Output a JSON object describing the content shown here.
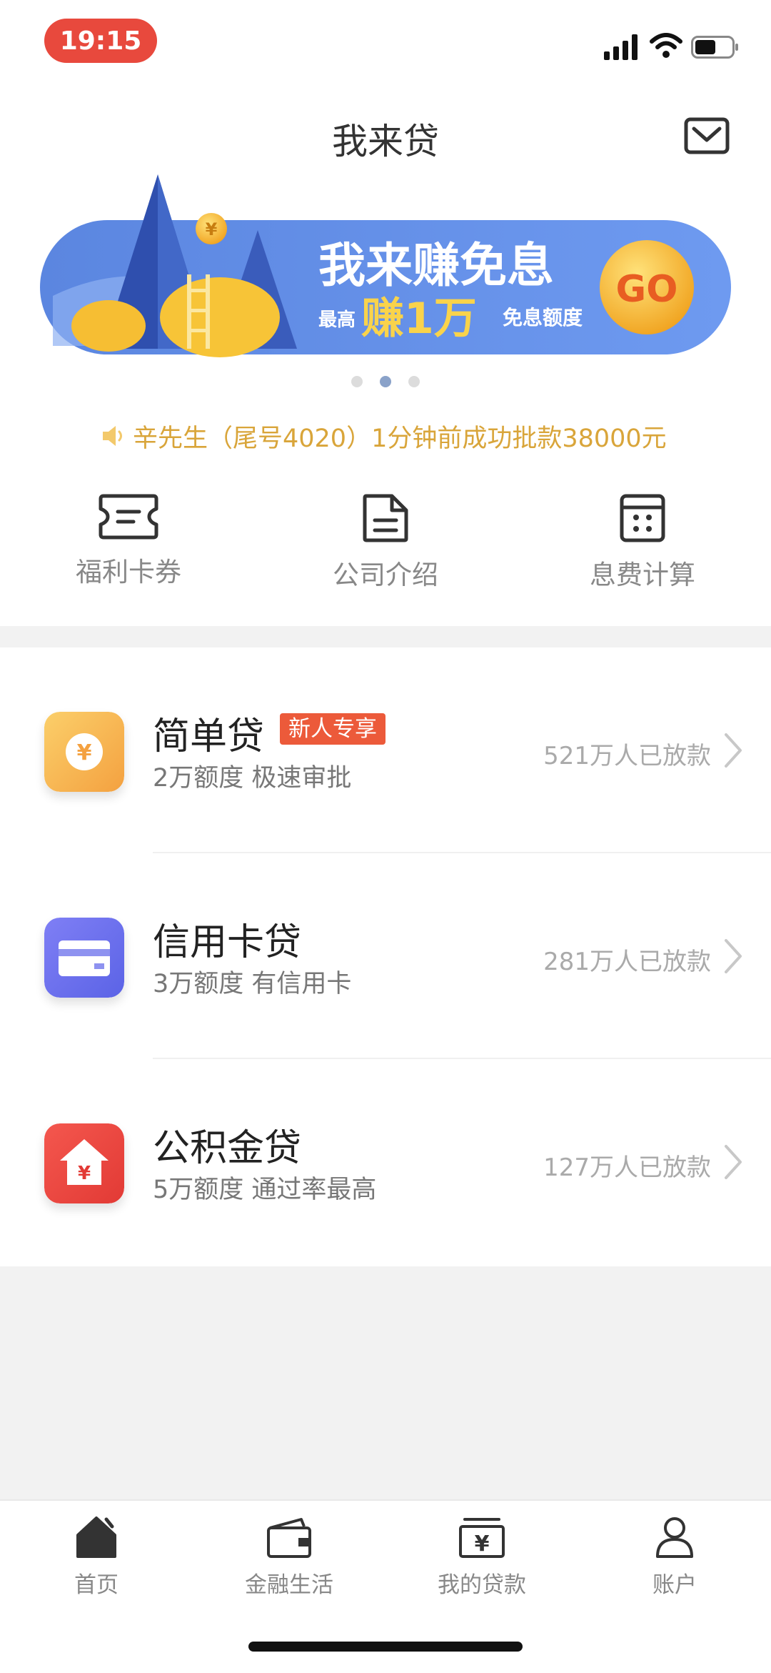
{
  "status_bar": {
    "time": "19:15"
  },
  "header": {
    "title": "我来贷",
    "mail_icon": "mail-icon"
  },
  "banner": {
    "headline": "我来赚免息",
    "line_prefix": "最高",
    "line_main": "赚1万",
    "line_suffix": "免息额度",
    "go": "GO",
    "coin": "¥",
    "page_count": 3,
    "active_page": 2
  },
  "notice": {
    "text": "辛先生（尾号4020）1分钟前成功批款38000元",
    "color": "#d9a53a"
  },
  "quick_actions": [
    {
      "label": "福利卡券",
      "icon": "coupon-ticket-icon"
    },
    {
      "label": "公司介绍",
      "icon": "document-icon"
    },
    {
      "label": "息费计算",
      "icon": "calculator-icon"
    }
  ],
  "loans": [
    {
      "name": "简单贷",
      "badge": "新人专享",
      "subtitle": "2万额度 极速审批",
      "count": "521万人已放款",
      "icon": "yen-coin-icon",
      "symbol": "¥"
    },
    {
      "name": "信用卡贷",
      "subtitle": "3万额度 有信用卡",
      "count": "281万人已放款",
      "icon": "credit-card-icon"
    },
    {
      "name": "公积金贷",
      "subtitle": "5万额度 通过率最高",
      "count": "127万人已放款",
      "icon": "house-fund-icon",
      "symbol": "¥"
    }
  ],
  "tab_bar": [
    {
      "label": "首页",
      "icon": "home-icon",
      "active": true
    },
    {
      "label": "金融生活",
      "icon": "wallet-icon"
    },
    {
      "label": "我的贷款",
      "icon": "loan-box-icon",
      "symbol": "¥"
    },
    {
      "label": "账户",
      "icon": "user-icon"
    }
  ],
  "colors": {
    "accent": "#e8493d",
    "banner_blue": "#6b91e6",
    "badge": "#ec5a3a",
    "gold": "#f5b731"
  }
}
